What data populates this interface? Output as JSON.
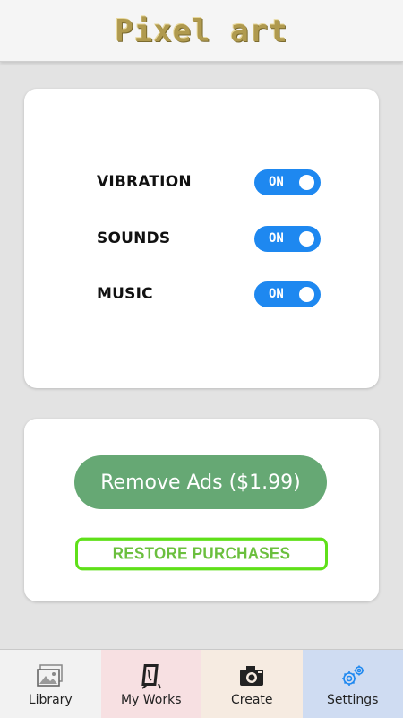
{
  "app": {
    "logo_text": "Pixel art"
  },
  "settings": {
    "rows": [
      {
        "label": "VIBRATION",
        "state": "ON"
      },
      {
        "label": "SOUNDS",
        "state": "ON"
      },
      {
        "label": "MUSIC",
        "state": "ON"
      }
    ]
  },
  "purchase": {
    "remove_ads_label": "Remove Ads ($1.99)",
    "restore_label": "RESTORE PURCHASES"
  },
  "tabs": [
    {
      "label": "Library",
      "icon": "gallery-icon"
    },
    {
      "label": "My Works",
      "icon": "frame-icon"
    },
    {
      "label": "Create",
      "icon": "camera-icon"
    },
    {
      "label": "Settings",
      "icon": "gears-icon"
    }
  ],
  "colors": {
    "toggle_on": "#1e88f0",
    "remove_ads_bg": "#66a874",
    "restore_border": "#5fe019",
    "logo_gold": "#b09a4f"
  }
}
